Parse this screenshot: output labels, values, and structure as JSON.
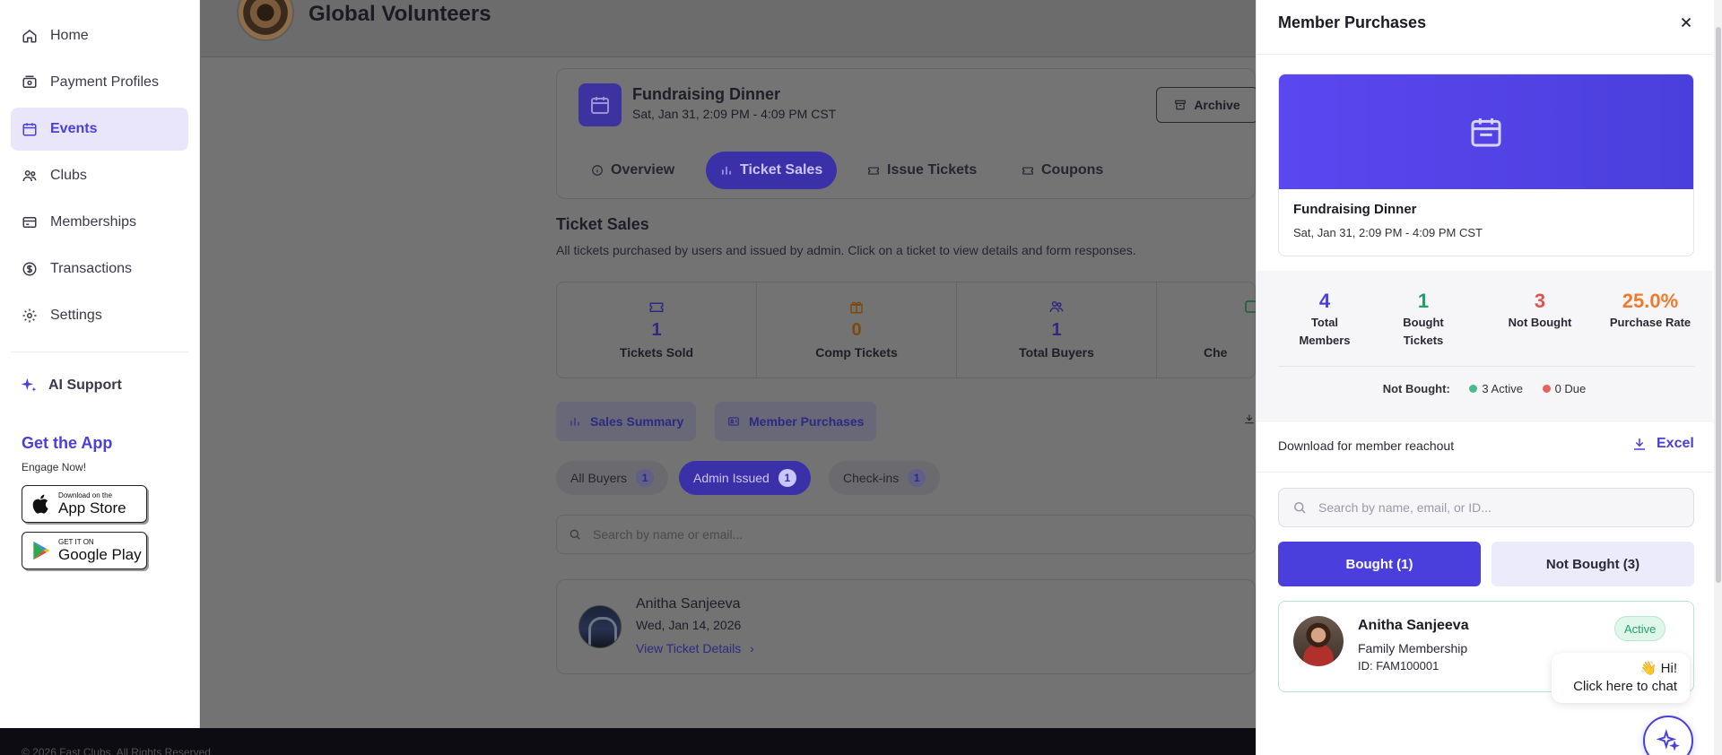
{
  "sidebar": {
    "items": [
      {
        "label": "Home",
        "icon": "home-icon"
      },
      {
        "label": "Payment Profiles",
        "icon": "payment-icon"
      },
      {
        "label": "Events",
        "icon": "calendar-icon",
        "active": true
      },
      {
        "label": "Clubs",
        "icon": "users-icon"
      },
      {
        "label": "Memberships",
        "icon": "card-icon"
      },
      {
        "label": "Transactions",
        "icon": "dollar-icon"
      },
      {
        "label": "Settings",
        "icon": "gear-icon"
      }
    ],
    "ai_support": "AI Support",
    "get_app": "Get the App",
    "engage": "Engage Now!",
    "app_store": {
      "small": "Download on the",
      "big": "App Store"
    },
    "google_play": {
      "small": "GET IT ON",
      "big": "Google Play"
    }
  },
  "header": {
    "org_name": "Global Volunteers"
  },
  "event": {
    "title": "Fundraising Dinner",
    "date": "Sat, Jan 31, 2:09 PM - 4:09 PM CST",
    "archive_label": "Archive"
  },
  "tabs": [
    {
      "label": "Overview"
    },
    {
      "label": "Ticket Sales",
      "active": true
    },
    {
      "label": "Issue Tickets"
    },
    {
      "label": "Coupons"
    }
  ],
  "ticket_sales": {
    "title": "Ticket Sales",
    "description": "All tickets purchased by users and issued by admin. Click on a ticket to view details and form responses.",
    "stats": [
      {
        "value": "1",
        "label": "Tickets Sold",
        "color": "#2d2a80"
      },
      {
        "value": "0",
        "label": "Comp Tickets",
        "color": "#7a4a10"
      },
      {
        "value": "1",
        "label": "Total Buyers",
        "color": "#2d2a80"
      },
      {
        "value": "",
        "label": "Che",
        "color": "#1e5a3a"
      }
    ],
    "buttons": {
      "sales_summary": "Sales Summary",
      "member_purchases": "Member Purchases"
    },
    "filters": [
      {
        "label": "All Buyers",
        "count": "1"
      },
      {
        "label": "Admin Issued",
        "count": "1",
        "active": true
      },
      {
        "label": "Check-ins",
        "count": "1"
      }
    ],
    "search_placeholder": "Search by name or email...",
    "buyer": {
      "name": "Anitha Sanjeeva",
      "date": "Wed, Jan 14, 2026",
      "link": "View Ticket Details"
    }
  },
  "footer": {
    "copyright": "© 2026 Fast Clubs. All Rights Reserved."
  },
  "drawer": {
    "title": "Member Purchases",
    "event_title": "Fundraising Dinner",
    "event_date": "Sat, Jan 31, 2:09 PM - 4:09 PM CST",
    "stats": [
      {
        "value": "4",
        "label_1": "Total",
        "label_2": "Members",
        "color": "#4a3fdc"
      },
      {
        "value": "1",
        "label_1": "Bought",
        "label_2": "Tickets",
        "color": "#22a06b"
      },
      {
        "value": "3",
        "label_1": "Not Bought",
        "label_2": "",
        "color": "#e0534f"
      },
      {
        "value": "25.0%",
        "label_1": "Purchase Rate",
        "label_2": "",
        "color": "#f07a2a"
      }
    ],
    "not_bought": {
      "label": "Not Bought:",
      "active": "3 Active",
      "due": "0 Due"
    },
    "download_text": "Download for member reachout",
    "excel_label": "Excel",
    "search_placeholder": "Search by name, email, or ID...",
    "seg_bought": "Bought (1)",
    "seg_not_bought": "Not Bought (3)",
    "member": {
      "name": "Anitha Sanjeeva",
      "plan": "Family Membership",
      "id": "ID: FAM100001",
      "status": "Active"
    }
  },
  "chat": {
    "line1": "👋 Hi!",
    "line2": "Click here to chat"
  }
}
